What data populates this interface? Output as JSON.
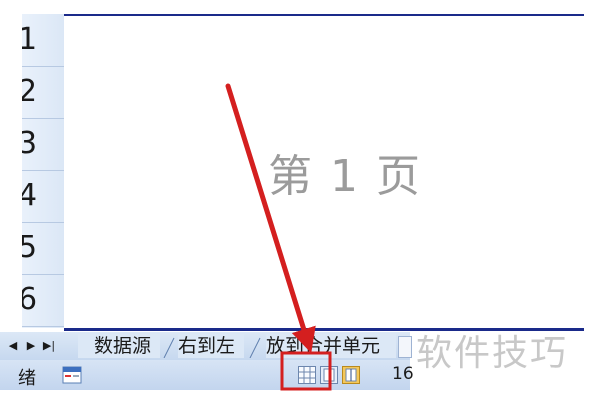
{
  "row_headers": [
    "1",
    "2",
    "3",
    "4",
    "5",
    "6"
  ],
  "page": {
    "watermark": "第 1 页"
  },
  "sheet_tabs": [
    "数据源",
    "右到左",
    "放到合并单元"
  ],
  "status": {
    "text": "绪",
    "zoom": "16"
  },
  "view_buttons": [
    {
      "icon": "normal-view-icon"
    },
    {
      "icon": "page-layout-icon"
    },
    {
      "icon": "page-break-preview-icon"
    }
  ],
  "annotation": {
    "arrow_color": "#d41f1f",
    "highlight_color": "#d41f1f"
  },
  "brand": {
    "text": "软件技巧"
  },
  "colors": {
    "page_border": "#1a2a8a",
    "chrome": "#c6d8ef"
  }
}
